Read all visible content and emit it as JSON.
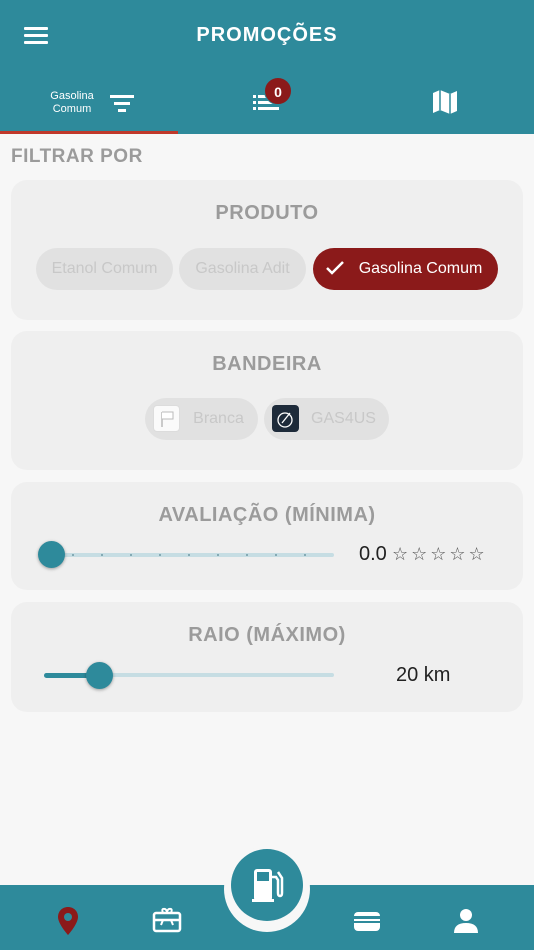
{
  "header": {
    "title": "PROMOÇÕES",
    "tabs": [
      {
        "label": "Gasolina Comum",
        "icon": "filter-icon",
        "active": true
      },
      {
        "label": "",
        "icon": "list-icon",
        "badge": "0"
      },
      {
        "label": "",
        "icon": "map-icon"
      }
    ]
  },
  "filter": {
    "title": "FILTRAR POR",
    "produto": {
      "title": "PRODUTO",
      "options": [
        {
          "label": "Etanol Comum",
          "selected": false
        },
        {
          "label": "Gasolina Adit",
          "selected": false
        },
        {
          "label": "Gasolina Comum",
          "selected": true
        }
      ]
    },
    "bandeira": {
      "title": "BANDEIRA",
      "options": [
        {
          "label": "Branca",
          "icon": "flag-icon"
        },
        {
          "label": "GAS4US",
          "icon": "gas4us-logo-icon"
        }
      ]
    },
    "avaliacao": {
      "title": "AVALIAÇÃO (MÍNIMA)",
      "value": "0.0",
      "stars": "☆☆☆☆☆",
      "level": 0,
      "max": 5
    },
    "raio": {
      "title": "RAIO (MÁXIMO)",
      "value": "20 km",
      "level_fraction": 0.19
    }
  },
  "bottom_nav": {
    "items": [
      "map-pin-icon",
      "gift-card-icon",
      "fuel-pump-icon",
      "wallet-icon",
      "user-icon"
    ],
    "active": "map-pin-icon"
  },
  "colors": {
    "primary": "#2e8a9b",
    "accent": "#8b1a1a",
    "active_indicator": "#c0392b"
  }
}
